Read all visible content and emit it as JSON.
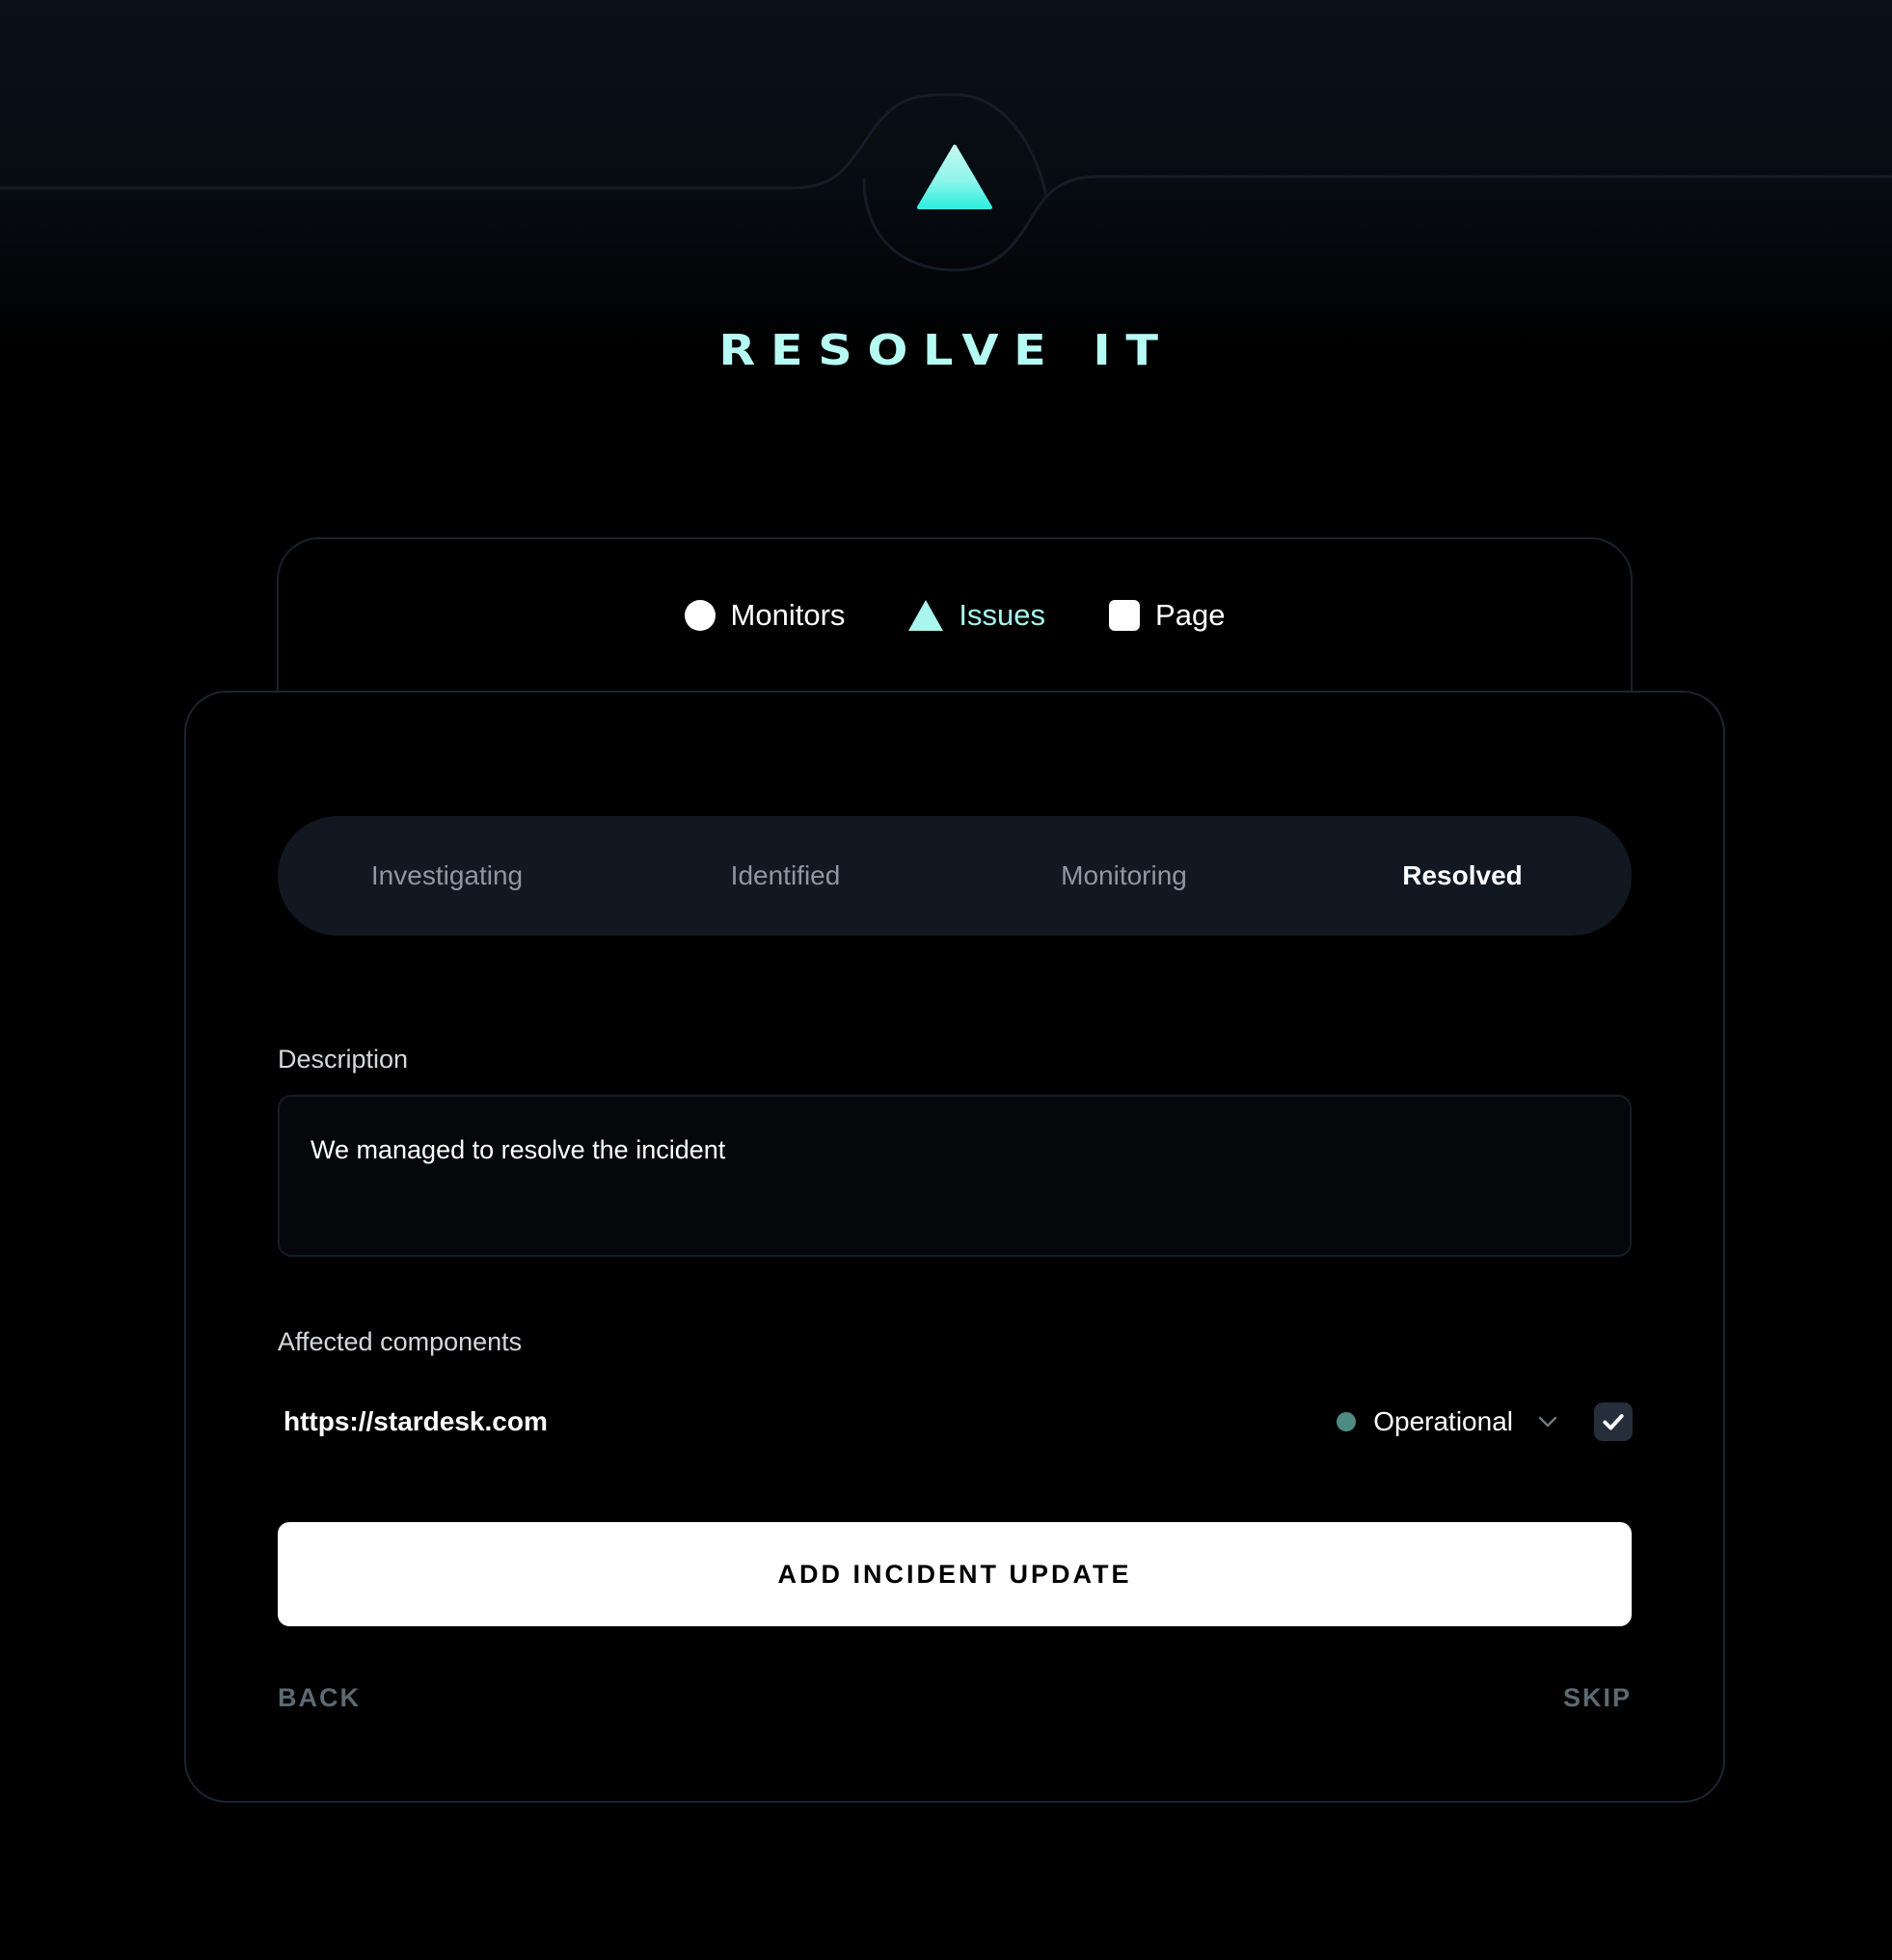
{
  "hero": {
    "icon": "triangle-icon",
    "title": "RESOLVE IT",
    "colors": {
      "accent": "#b6fbf3",
      "triangle_top": "#c3f9f3",
      "triangle_bottom": "#2ff0e0"
    }
  },
  "nav": {
    "items": [
      {
        "label": "Monitors",
        "icon": "circle-icon",
        "active": false
      },
      {
        "label": "Issues",
        "icon": "triangle-icon",
        "active": true
      },
      {
        "label": "Page",
        "icon": "square-icon",
        "active": false
      }
    ]
  },
  "status_tabs": {
    "items": [
      "Investigating",
      "Identified",
      "Monitoring",
      "Resolved"
    ],
    "selected": "Resolved"
  },
  "form": {
    "description_label": "Description",
    "description_value": "We managed to resolve the incident",
    "components_label": "Affected components",
    "components": [
      {
        "url": "https://stardesk.com",
        "status": "Operational",
        "status_color": "#4f8a85",
        "checked": true
      }
    ],
    "submit_label": "ADD INCIDENT UPDATE",
    "back_label": "BACK",
    "skip_label": "SKIP"
  }
}
